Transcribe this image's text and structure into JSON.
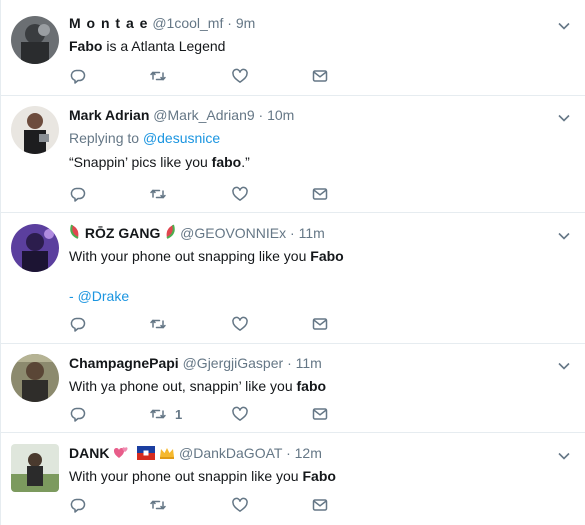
{
  "colors": {
    "accent": "#1b95e0",
    "muted": "#657786",
    "text": "#14171a",
    "divider": "#e6ecf0"
  },
  "tweets": [
    {
      "name": "M o n t a e",
      "handle": "@1cool_mf",
      "separator": "·",
      "time": "9m",
      "text_bold": "Fabo",
      "text_rest": " is a Atlanta Legend",
      "retweet_count": ""
    },
    {
      "name": "Mark Adrian",
      "handle": "@Mark_Adrian9",
      "separator": "·",
      "time": "10m",
      "replying_label": "Replying to",
      "replying_to": "@desusnice",
      "text_pre": "“Snappin’ pics like you ",
      "text_bold": "fabo",
      "text_post": ".”",
      "retweet_count": ""
    },
    {
      "name": "RŌZ GANG",
      "handle": "@GEOVONNIEx",
      "separator": "·",
      "time": "11m",
      "text_pre": "With your phone out snapping like you ",
      "text_bold": "Fabo",
      "text_line2_prefix": "- ",
      "text_line2_link": "@Drake",
      "retweet_count": ""
    },
    {
      "name": "ChampagnePapi",
      "handle": "@GjergjiGasper",
      "separator": "·",
      "time": "11m",
      "text_pre": "With ya phone out, snappin’ like you ",
      "text_bold": "fabo",
      "retweet_count": "1"
    },
    {
      "name": "DANK",
      "handle": "@DankDaGOAT",
      "separator": "·",
      "time": "12m",
      "text_pre": "With your phone out snappin like you ",
      "text_bold": "Fabo",
      "retweet_count": ""
    }
  ],
  "icons": {
    "reply": "reply-icon",
    "retweet": "retweet-icon",
    "like": "heart-icon",
    "message": "envelope-icon",
    "caret": "chevron-down-icon"
  }
}
